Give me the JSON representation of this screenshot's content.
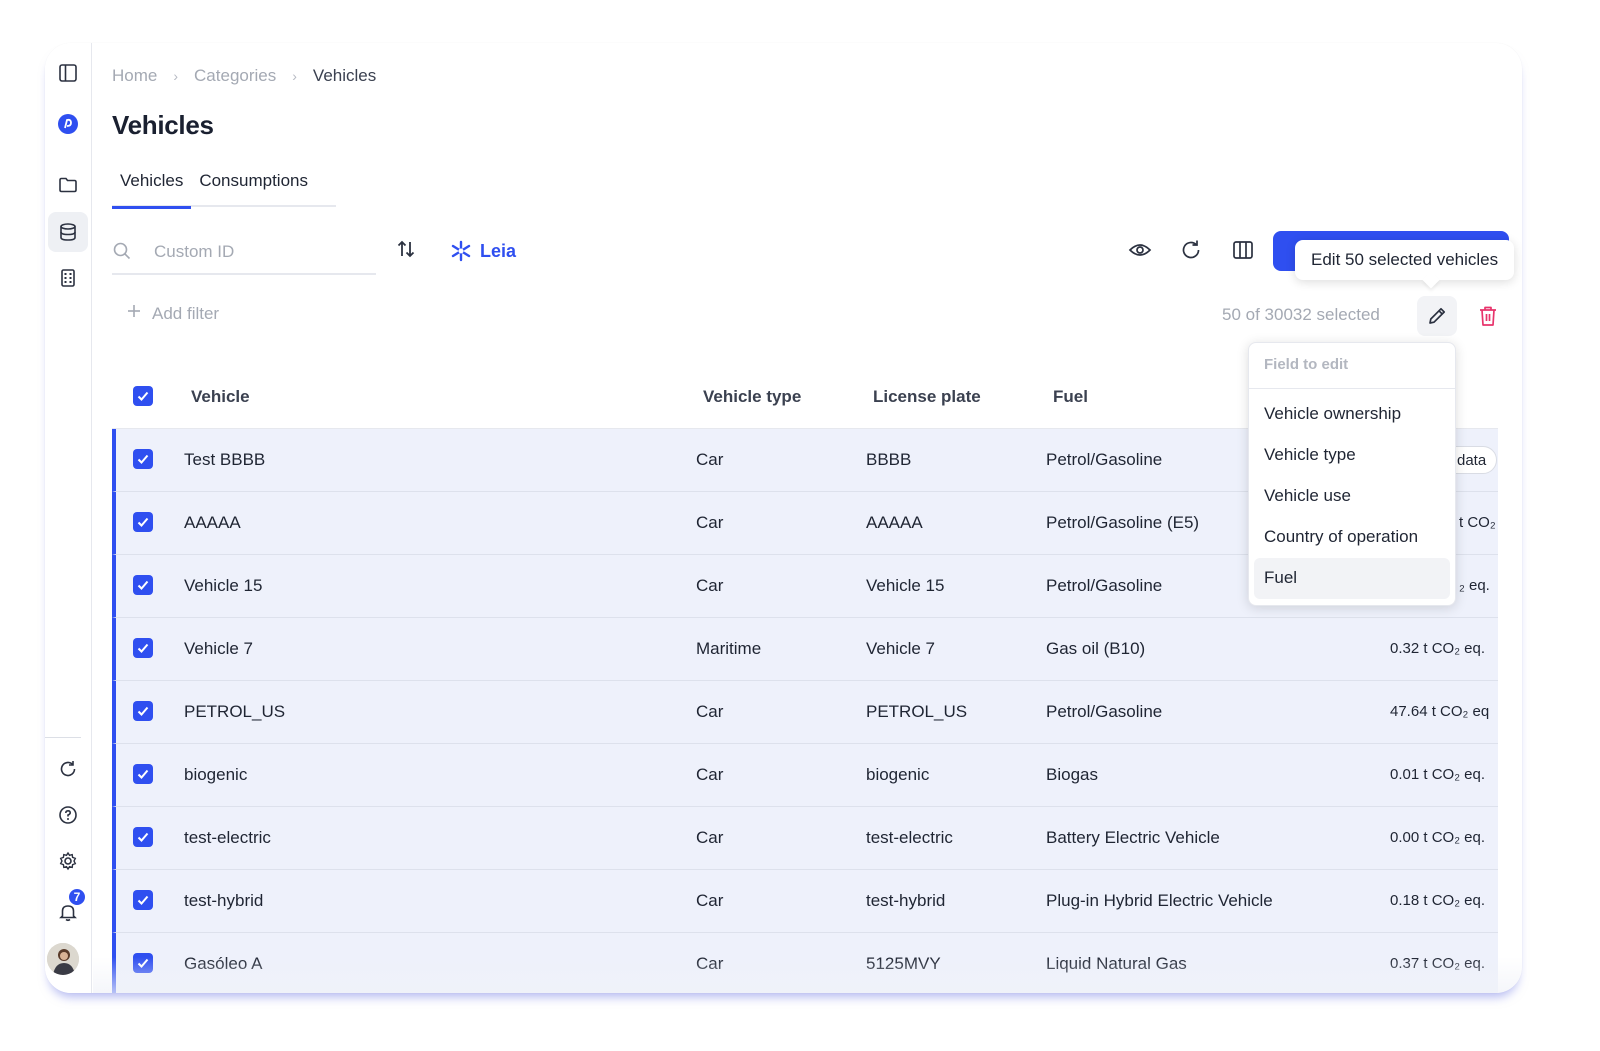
{
  "breadcrumb": {
    "home": "Home",
    "categories": "Categories",
    "current": "Vehicles"
  },
  "page": {
    "title": "Vehicles"
  },
  "tabs": [
    {
      "label": "Vehicles",
      "active": true
    },
    {
      "label": "Consumptions",
      "active": false
    }
  ],
  "search": {
    "placeholder": "Custom ID",
    "value": ""
  },
  "toolbar": {
    "leia_label": "Leia",
    "tooltip": "Edit 50 selected vehicles"
  },
  "filter": {
    "add_label": "Add filter"
  },
  "selection": {
    "count_text": "50 of 30032 selected"
  },
  "dropdown": {
    "header": "Field to edit",
    "items": [
      "Vehicle ownership",
      "Vehicle type",
      "Vehicle use",
      "Country of operation",
      "Fuel"
    ],
    "hovered": "Fuel"
  },
  "table": {
    "columns": {
      "vehicle": "Vehicle",
      "type": "Vehicle type",
      "plate": "License plate",
      "fuel": "Fuel"
    },
    "rows": [
      {
        "vehicle": "Test BBBB",
        "type": "Car",
        "plate": "BBBB",
        "fuel": "Petrol/Gasoline",
        "emissions": "data"
      },
      {
        "vehicle": "AAAAA",
        "type": "Car",
        "plate": "AAAAA",
        "fuel": "Petrol/Gasoline (E5)",
        "emissions": "t CO₂"
      },
      {
        "vehicle": "Vehicle 15",
        "type": "Car",
        "plate": "Vehicle 15",
        "fuel": "Petrol/Gasoline",
        "emissions": "₂ eq."
      },
      {
        "vehicle": "Vehicle 7",
        "type": "Maritime",
        "plate": "Vehicle 7",
        "fuel": "Gas oil (B10)",
        "emissions": "0.32 t CO₂ eq."
      },
      {
        "vehicle": "PETROL_US",
        "type": "Car",
        "plate": "PETROL_US",
        "fuel": "Petrol/Gasoline",
        "emissions": "47.64 t CO₂ eq"
      },
      {
        "vehicle": "biogenic",
        "type": "Car",
        "plate": "biogenic",
        "fuel": "Biogas",
        "emissions": "0.01 t CO₂ eq."
      },
      {
        "vehicle": "test-electric",
        "type": "Car",
        "plate": "test-electric",
        "fuel": "Battery Electric Vehicle",
        "emissions": "0.00 t CO₂ eq."
      },
      {
        "vehicle": "test-hybrid",
        "type": "Car",
        "plate": "test-hybrid",
        "fuel": "Plug-in Hybrid Electric Vehicle",
        "emissions": "0.18 t CO₂ eq."
      },
      {
        "vehicle": "Gasóleo A",
        "type": "Car",
        "plate": "5125MVY",
        "fuel": "Liquid Natural Gas",
        "emissions": "0.37 t CO₂ eq."
      }
    ]
  },
  "sidebar": {
    "notification_count": "7",
    "icons": [
      "sidebar-toggle-icon",
      "brand-logo-icon",
      "folder-icon",
      "database-icon",
      "building-icon",
      "refresh-icon",
      "help-icon",
      "settings-icon",
      "bell-icon"
    ]
  },
  "colors": {
    "accent": "#2f4ff0",
    "danger": "#e8336b",
    "row_selected": "#eef1fb"
  }
}
